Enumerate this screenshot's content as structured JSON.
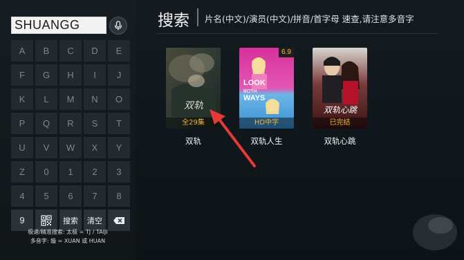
{
  "search": {
    "query": "SHUANGG"
  },
  "keyboard": {
    "rows": [
      [
        "A",
        "B",
        "C",
        "D",
        "E"
      ],
      [
        "F",
        "G",
        "H",
        "I",
        "J"
      ],
      [
        "K",
        "L",
        "M",
        "N",
        "O"
      ],
      [
        "P",
        "Q",
        "R",
        "S",
        "T"
      ],
      [
        "U",
        "V",
        "W",
        "X",
        "Y"
      ],
      [
        "Z",
        "0",
        "1",
        "2",
        "3"
      ],
      [
        "4",
        "5",
        "6",
        "7",
        "8"
      ]
    ],
    "last_row": {
      "nine": "9",
      "search": "搜索",
      "clear": "清空"
    }
  },
  "hints": {
    "line1": "极速/精准搜索: 太极 = TJ / TAIJI",
    "line2": "多音字: 嫙 = XUAN 或 HUAN"
  },
  "header": {
    "title": "搜索",
    "hint": "片名(中文)/演员(中文)/拼音/首字母 速查,请注意多音字"
  },
  "results": [
    {
      "title": "双轨",
      "badge": "全29集",
      "badge_color": "#f2b53a",
      "art_text": "双轨"
    },
    {
      "title": "双轨人生",
      "badge": "HD中字",
      "badge_color": "#f2b53a",
      "rating": "6.9",
      "art_text": "LOOK BOTH WAYS"
    },
    {
      "title": "双轨心跳",
      "badge": "已完结",
      "badge_color": "#f2b53a",
      "art_text": "双轨心跳"
    }
  ],
  "colors": {
    "accent": "#f2b53a",
    "arrow": "#e53935"
  }
}
